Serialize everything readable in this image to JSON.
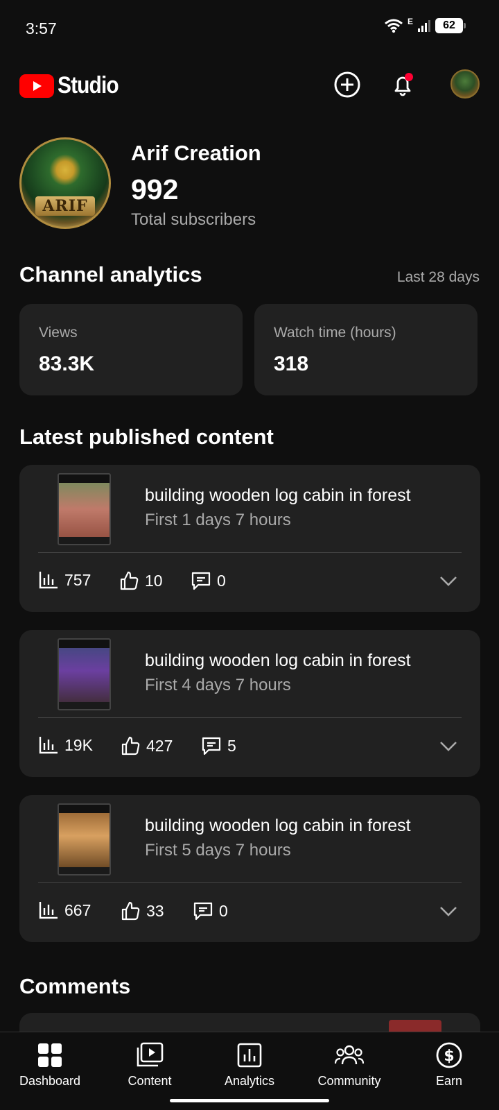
{
  "status_bar": {
    "time": "3:57",
    "battery": "62",
    "network_type": "E"
  },
  "header": {
    "logo_text": "Studio",
    "create_icon": "plus-circle-icon",
    "notifications_icon": "bell-icon",
    "notification_dot_color": "#ff0000"
  },
  "channel": {
    "name": "Arif Creation",
    "subscribers": "992",
    "subscribers_label": "Total subscribers",
    "avatar_text": "ARIF"
  },
  "analytics": {
    "title": "Channel analytics",
    "range": "Last 28 days",
    "stats": [
      {
        "label": "Views",
        "value": "83.3K"
      },
      {
        "label": "Watch time (hours)",
        "value": "318"
      }
    ]
  },
  "latest": {
    "title": "Latest published content",
    "items": [
      {
        "title": "building wooden log cabin in forest",
        "subtitle": "First 1 days 7 hours",
        "views": "757",
        "likes": "10",
        "comments": "0"
      },
      {
        "title": "building wooden log cabin in forest",
        "subtitle": "First 4 days 7 hours",
        "views": "19K",
        "likes": "427",
        "comments": "5"
      },
      {
        "title": "building wooden log cabin in forest",
        "subtitle": "First 5 days 7 hours",
        "views": "667",
        "likes": "33",
        "comments": "0"
      }
    ]
  },
  "comments": {
    "title": "Comments"
  },
  "bottom_nav": [
    {
      "label": "Dashboard",
      "icon": "dashboard-icon"
    },
    {
      "label": "Content",
      "icon": "content-icon"
    },
    {
      "label": "Analytics",
      "icon": "analytics-icon"
    },
    {
      "label": "Community",
      "icon": "community-icon"
    },
    {
      "label": "Earn",
      "icon": "earn-icon"
    }
  ],
  "colors": {
    "background": "#0f0f0f",
    "card": "#212121",
    "brand_red": "#ff0000",
    "secondary_text": "#aaaaaa"
  }
}
